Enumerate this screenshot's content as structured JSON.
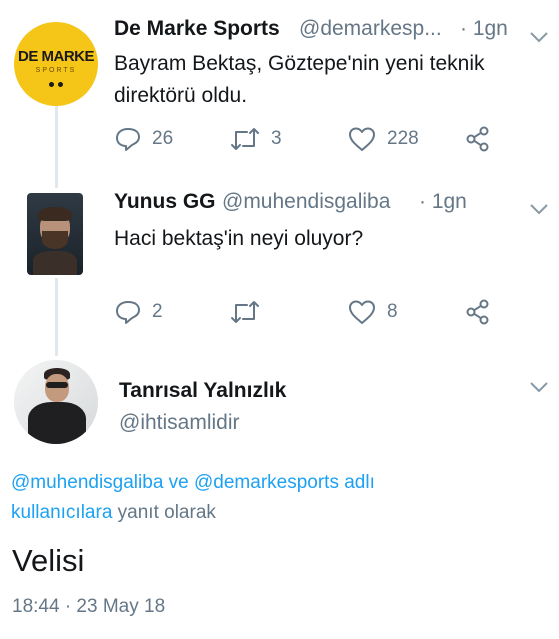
{
  "colors": {
    "accent": "#1da1f2",
    "muted": "#657786",
    "text": "#14171a",
    "brand_yellow": "#f5c518"
  },
  "tweet1": {
    "name": "De Marke Sports",
    "handle": "@demarkesp...",
    "time": "· 1gn",
    "text_line1": "Bayram Bektaş, Göztepe'nin yeni teknik",
    "text_line2": "direktörü oldu.",
    "avatar_logo_main": "DE MARKE",
    "avatar_logo_sub": "SPORTS",
    "replies": "26",
    "retweets": "3",
    "likes": "228"
  },
  "tweet2": {
    "name": "Yunus GG",
    "handle": "@muhendisgaliba",
    "time": "· 1gn",
    "text": "Haci bektaş'in neyi oluyor?",
    "replies": "2",
    "retweets": "",
    "likes": "8"
  },
  "tweet3": {
    "name": "Tanrısal Yalnızlık",
    "handle": "@ihtisamlidir",
    "reply_to_mention1": "@muhendisgaliba",
    "reply_to_and": " ve ",
    "reply_to_mention2": "@demarkesports adlı",
    "reply_to_mention3": "kullanıcılara",
    "reply_to_suffix": " yanıt olarak",
    "text": "Velisi",
    "timestamp": "18:44 · 23 May 18"
  }
}
